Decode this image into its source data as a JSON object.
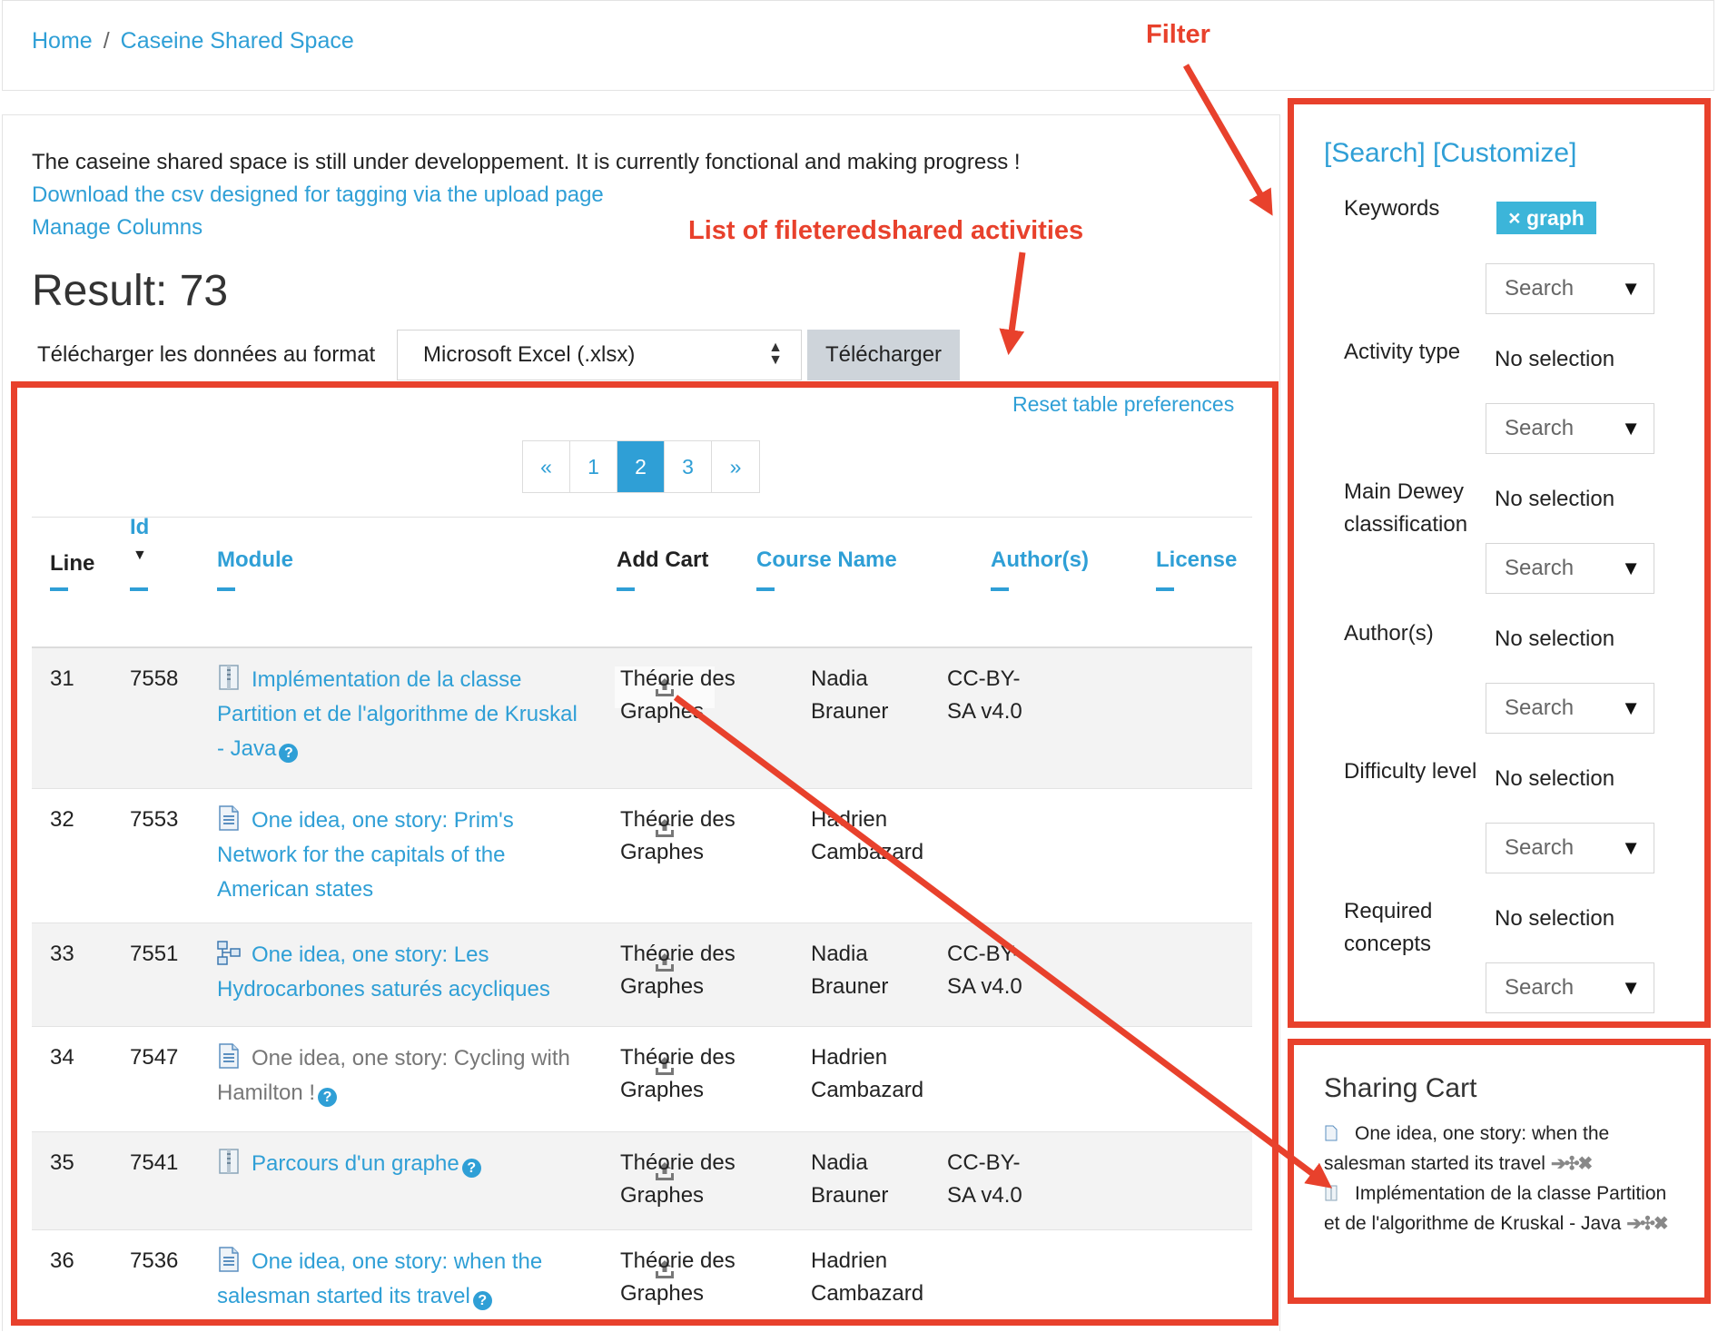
{
  "breadcrumb": {
    "home": "Home",
    "separator": "/",
    "current": "Caseine Shared Space"
  },
  "notice": {
    "message": "The caseine shared space is still under developpement. It is currently fonctional and making progress !",
    "download_csv": "Download the csv designed for tagging via the upload page",
    "manage_columns": "Manage Columns"
  },
  "result": "Result: 73",
  "download": {
    "label": "Télécharger les données au format",
    "format": "Microsoft Excel (.xlsx)",
    "button": "Télécharger"
  },
  "table": {
    "reset": "Reset table preferences",
    "pagination": {
      "prev": "«",
      "pages": [
        "1",
        "2",
        "3"
      ],
      "active": "2",
      "next": "»"
    },
    "headers": {
      "line": "Line",
      "id": "Id",
      "module": "Module",
      "add_cart": "Add Cart",
      "course": "Course Name",
      "authors": "Author(s)",
      "license": "License"
    },
    "rows": [
      {
        "line": "31",
        "id": "7558",
        "module": "Implémentation de la classe Partition et de l'algorithme de Kruskal - Java",
        "course": "Théorie des Graphes",
        "author": "Nadia Brauner",
        "license": "CC-BY-SA v4.0"
      },
      {
        "line": "32",
        "id": "7553",
        "module": "One idea, one story: Prim's Network for the capitals of the American states",
        "course": "Théorie des Graphes",
        "author": "Hadrien Cambazard",
        "license": ""
      },
      {
        "line": "33",
        "id": "7551",
        "module": "One idea, one story: Les Hydrocarbones saturés acycliques",
        "course": "Théorie des Graphes",
        "author": "Nadia Brauner",
        "license": "CC-BY-SA v4.0"
      },
      {
        "line": "34",
        "id": "7547",
        "module": "One idea, one story: Cycling with Hamilton !",
        "course": "Théorie des Graphes",
        "author": "Hadrien Cambazard",
        "license": ""
      },
      {
        "line": "35",
        "id": "7541",
        "module": "Parcours d'un graphe",
        "course": "Théorie des Graphes",
        "author": "Nadia Brauner",
        "license": "CC-BY-SA v4.0"
      },
      {
        "line": "36",
        "id": "7536",
        "module": "One idea, one story: when the salesman started its travel",
        "course": "Théorie des Graphes",
        "author": "Hadrien Cambazard",
        "license": ""
      }
    ]
  },
  "filter": {
    "title": "[Search] [Customize]",
    "keywords_label": "Keywords",
    "keyword_tag": "× graph",
    "search_placeholder": "Search",
    "no_selection": "No selection",
    "activity_type": "Activity type",
    "dewey": "Main Dewey classification",
    "authors": "Author(s)",
    "difficulty": "Difficulty level",
    "concepts": "Required concepts"
  },
  "sharing_cart": {
    "title": "Sharing Cart",
    "items": [
      "One idea, one story: when the salesman started its travel",
      "Implémentation de la classe Partition et de l'algorithme de Kruskal - Java"
    ]
  },
  "annotations": {
    "filter": "Filter",
    "list": "List of fileteredshared activities"
  },
  "colors": {
    "accent": "#2f9fd6",
    "annotation": "#e8412c",
    "tag": "#3cb5d9"
  }
}
